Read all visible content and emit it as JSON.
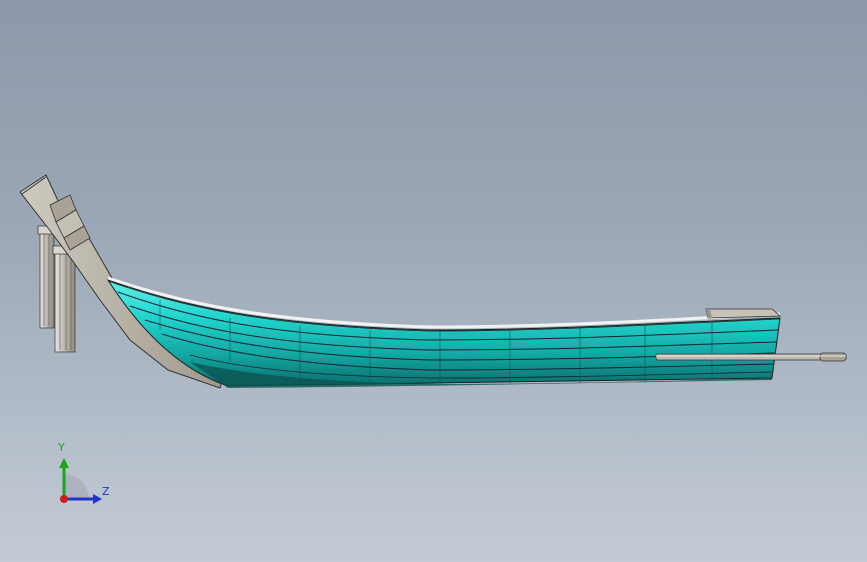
{
  "viewport": {
    "background_top": "#8d99aa",
    "background_bottom": "#c3cbd5",
    "model": "boat-hull-model"
  },
  "colors": {
    "hull": "#22cfc9",
    "hull_dark": "#0e7d7a",
    "wood": "#b7b1a5",
    "edge": "#2a2a2a"
  },
  "triad": {
    "y_label": "Y",
    "z_label": "Z",
    "y_color": "#1aa51a",
    "z_color": "#2233cc",
    "x_color": "#d21b1b"
  }
}
